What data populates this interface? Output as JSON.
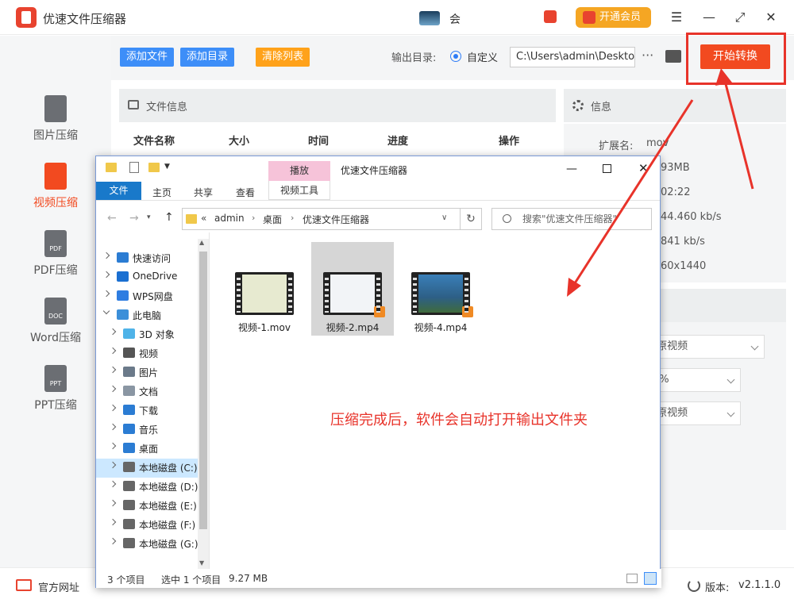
{
  "app": {
    "title": "优速文件压缩器",
    "vip_label": "开通会员",
    "user_label": "会",
    "controls": {
      "menu": "☰",
      "minimize": "—",
      "maximize": "⤢",
      "close": "✕"
    }
  },
  "sidebar": {
    "items": [
      {
        "label": "图片压缩",
        "icon": "image-file-icon",
        "active": false
      },
      {
        "label": "视频压缩",
        "icon": "video-file-icon",
        "active": true
      },
      {
        "label": "PDF压缩",
        "icon": "pdf-file-icon",
        "badge": "PDF",
        "active": false
      },
      {
        "label": "Word压缩",
        "icon": "doc-file-icon",
        "badge": "DOC",
        "active": false
      },
      {
        "label": "PPT压缩",
        "icon": "ppt-file-icon",
        "badge": "PPT",
        "active": false
      }
    ]
  },
  "toolbar": {
    "add_file": "添加文件",
    "add_dir": "添加目录",
    "clear_list": "清除列表",
    "output_label": "输出目录:",
    "custom_label": "自定义",
    "output_path": "C:\\Users\\admin\\Deskto",
    "more": "···",
    "start": "开始转换"
  },
  "file_panel": {
    "title": "文件信息",
    "columns": [
      "文件名称",
      "大小",
      "时间",
      "进度",
      "操作"
    ]
  },
  "info_panel": {
    "title": "信息",
    "ext_label": "扩展名:",
    "ext_value": "mov",
    "size_value": "93MB",
    "duration_value": "02:22",
    "bitrate1": "44.460 kb/s",
    "bitrate2": "841 kb/s",
    "resolution": "60x1440",
    "help": "?"
  },
  "settings": {
    "select1": "]原视频",
    "select2": "0%",
    "select3": "]原视频"
  },
  "footer": {
    "website": "官方网址",
    "version_label": "版本:",
    "version": "v2.1.1.0"
  },
  "explorer": {
    "title": "优速文件压缩器",
    "ribbon": {
      "file": "文件",
      "home": "主页",
      "share": "共享",
      "view": "查看",
      "play": "播放",
      "video_tools": "视频工具"
    },
    "breadcrumb": [
      "admin",
      "桌面",
      "优速文件压缩器"
    ],
    "crumb_prefix": "«",
    "search_placeholder": "搜索\"优速文件压缩器\"",
    "tree": [
      {
        "label": "快速访问",
        "indent": 0,
        "expanded": false,
        "icon": "star-icon",
        "color": "#2b7cd3"
      },
      {
        "label": "OneDrive",
        "indent": 0,
        "expanded": false,
        "icon": "cloud-icon",
        "color": "#1a6fd1"
      },
      {
        "label": "WPS网盘",
        "indent": 0,
        "expanded": false,
        "icon": "cloud-icon",
        "color": "#2f7de1"
      },
      {
        "label": "此电脑",
        "indent": 0,
        "expanded": true,
        "icon": "computer-icon",
        "color": "#3b8fd9"
      },
      {
        "label": "3D 对象",
        "indent": 1,
        "expanded": false,
        "icon": "cube-icon",
        "color": "#4fb3e8"
      },
      {
        "label": "视频",
        "indent": 1,
        "expanded": false,
        "icon": "video-folder-icon",
        "color": "#555555"
      },
      {
        "label": "图片",
        "indent": 1,
        "expanded": false,
        "icon": "picture-folder-icon",
        "color": "#6b7a8a"
      },
      {
        "label": "文档",
        "indent": 1,
        "expanded": false,
        "icon": "document-icon",
        "color": "#8a96a3"
      },
      {
        "label": "下载",
        "indent": 1,
        "expanded": false,
        "icon": "download-icon",
        "color": "#2b7cd3"
      },
      {
        "label": "音乐",
        "indent": 1,
        "expanded": false,
        "icon": "music-icon",
        "color": "#2b7cd3"
      },
      {
        "label": "桌面",
        "indent": 1,
        "expanded": false,
        "icon": "desktop-icon",
        "color": "#2b7cd3"
      },
      {
        "label": "本地磁盘 (C:)",
        "indent": 1,
        "expanded": false,
        "icon": "drive-icon",
        "color": "#666666",
        "selected": true
      },
      {
        "label": "本地磁盘 (D:)",
        "indent": 1,
        "expanded": false,
        "icon": "drive-icon",
        "color": "#666666"
      },
      {
        "label": "本地磁盘 (E:)",
        "indent": 1,
        "expanded": false,
        "icon": "drive-icon",
        "color": "#666666"
      },
      {
        "label": "本地磁盘 (F:)",
        "indent": 1,
        "expanded": false,
        "icon": "drive-icon",
        "color": "#666666"
      },
      {
        "label": "本地磁盘 (G:)",
        "indent": 1,
        "expanded": false,
        "icon": "drive-icon",
        "color": "#666666"
      }
    ],
    "files": [
      {
        "name": "视频-1.mov",
        "selected": false,
        "thumb_color": "#e7ead0"
      },
      {
        "name": "视频-2.mp4",
        "selected": true,
        "thumb_color": "#f2f4f7"
      },
      {
        "name": "视频-4.mp4",
        "selected": false,
        "thumb_color": "#3a7fb8"
      }
    ],
    "status": {
      "count": "3 个项目",
      "selected": "选中 1 个项目",
      "size": "9.27 MB"
    }
  },
  "annotation": "压缩完成后，软件会自动打开输出文件夹",
  "colors": {
    "accent": "#f24a20",
    "blue": "#3d8ef8",
    "orange": "#ffa21a",
    "annotation_red": "#e8332a"
  }
}
